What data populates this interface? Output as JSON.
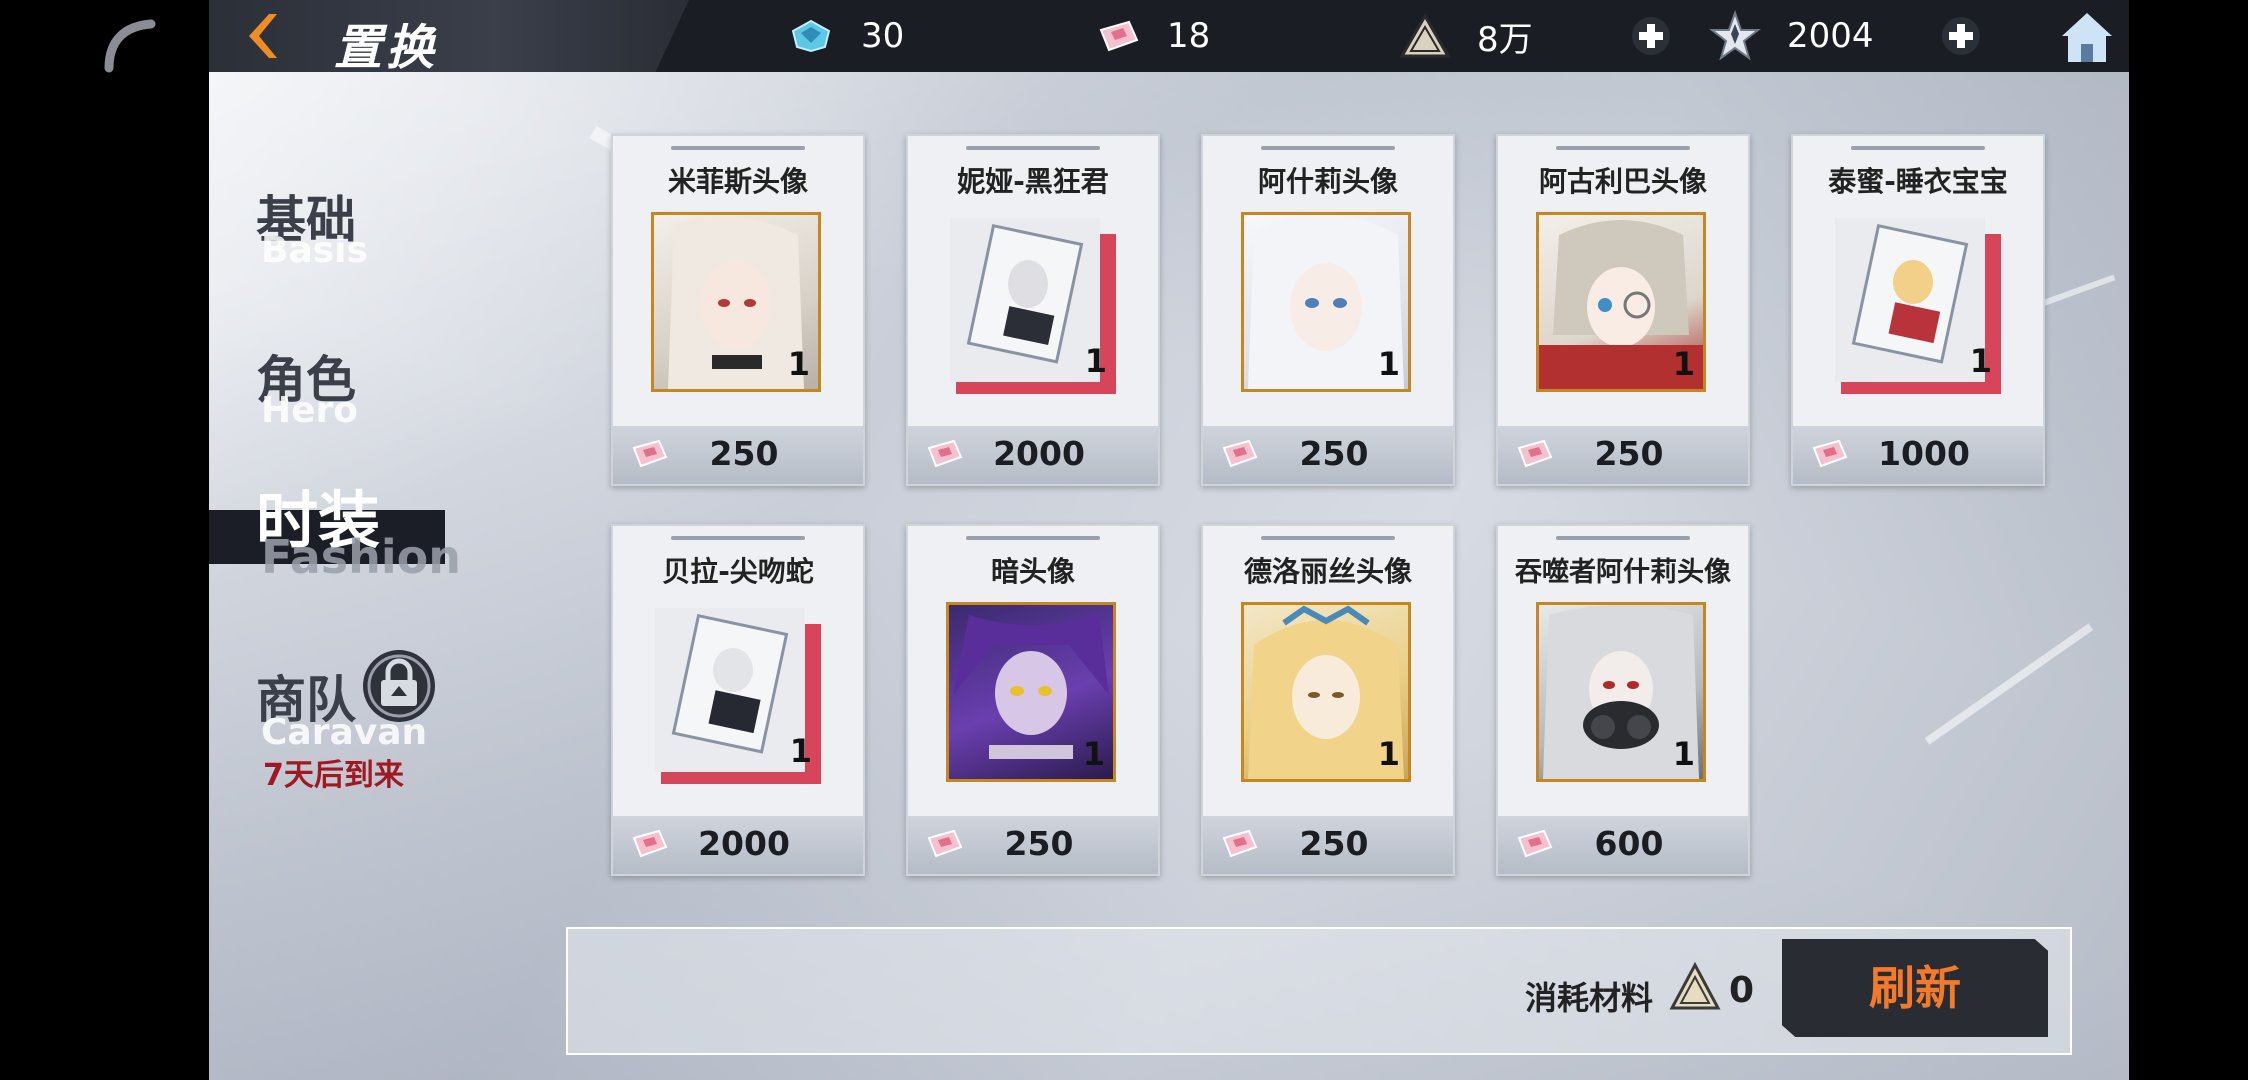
{
  "header": {
    "title": "置换",
    "resources": {
      "crystal": "30",
      "ticket": "18",
      "material": "8万",
      "star": "2004"
    }
  },
  "nav": {
    "items": [
      {
        "cn": "基础",
        "en": "Basis"
      },
      {
        "cn": "角色",
        "en": "Hero"
      },
      {
        "cn": "时装",
        "en": "Fashion"
      },
      {
        "cn": "商队",
        "en": "Caravan"
      }
    ],
    "active": "时装",
    "caravan_note": "7天后到来"
  },
  "items": [
    {
      "name": "米菲斯头像",
      "price": "250",
      "qty": "1",
      "kind": "portrait"
    },
    {
      "name": "妮娅-黑狂君",
      "price": "2000",
      "qty": "1",
      "kind": "card"
    },
    {
      "name": "阿什莉头像",
      "price": "250",
      "qty": "1",
      "kind": "portrait"
    },
    {
      "name": "阿古利巴头像",
      "price": "250",
      "qty": "1",
      "kind": "portrait"
    },
    {
      "name": "泰蜜-睡衣宝宝",
      "price": "1000",
      "qty": "1",
      "kind": "card"
    },
    {
      "name": "贝拉-尖吻蛇",
      "price": "2000",
      "qty": "1",
      "kind": "card"
    },
    {
      "name": "暗头像",
      "price": "250",
      "qty": "1",
      "kind": "portrait"
    },
    {
      "name": "德洛丽丝头像",
      "price": "250",
      "qty": "1",
      "kind": "portrait"
    },
    {
      "name": "吞噬者阿什莉头像",
      "price": "600",
      "qty": "1",
      "kind": "portrait"
    }
  ],
  "footer": {
    "cost_label": "消耗材料",
    "cost_value": "0",
    "refresh_label": "刷新"
  },
  "colors": {
    "accent_orange": "#f27a2a",
    "frame_gold": "#c7871f",
    "red_note": "#a01822",
    "dark_bar": "#1a1d24"
  },
  "icons": [
    "back-arrow-icon",
    "crystal-icon",
    "ticket-icon",
    "material-triangle-icon",
    "star-icon",
    "plus-icon",
    "home-icon",
    "lock-icon"
  ]
}
